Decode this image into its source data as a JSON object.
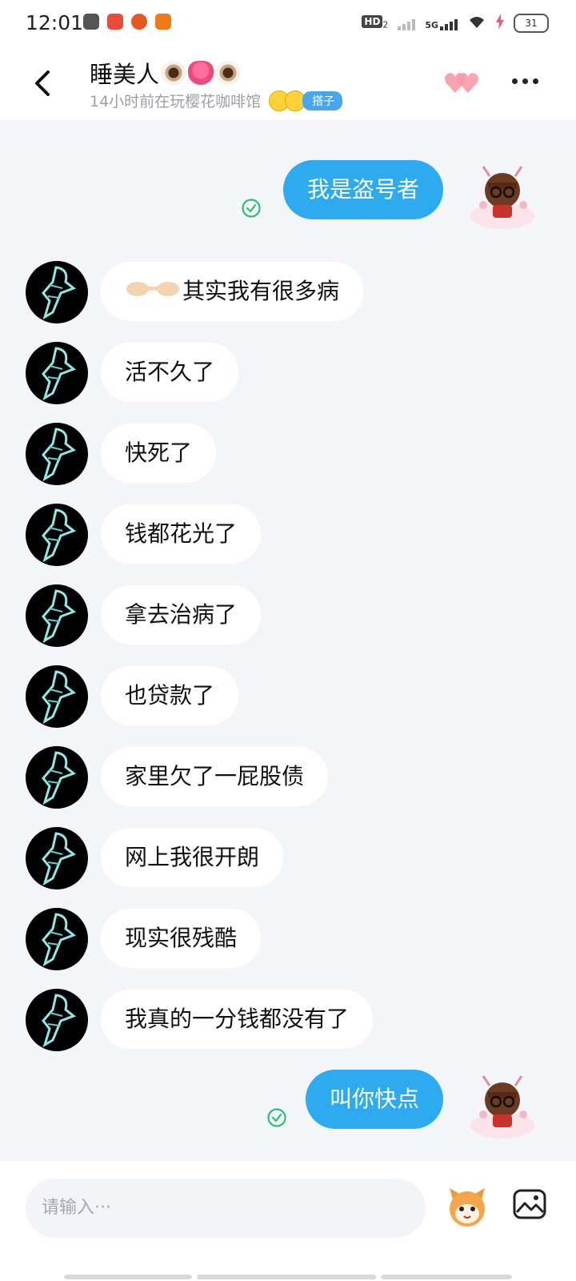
{
  "status_bar": {
    "time": "12:01",
    "network": "5G",
    "hd_label": "HD",
    "hd_sub": "2",
    "battery": "31"
  },
  "header": {
    "contact_name": "睡美人",
    "name_emojis": [
      "eye",
      "tongue",
      "eye"
    ],
    "last_active": "14小时前在玩樱花咖啡馆",
    "partner_tag": "搭子",
    "back_icon": "chevron-left-icon",
    "more_icon": "more-dots-icon",
    "hearts_icon": "double-heart-icon"
  },
  "colors": {
    "sent_bubble": "#2eaaf0",
    "received_bubble": "#ffffff",
    "chat_background": "#f3f5f9",
    "read_check": "#2bbf6e"
  },
  "messages": [
    {
      "side": "sent",
      "text": "我是盗号者",
      "read": true
    },
    {
      "side": "received",
      "emoji": "pointing-hands",
      "text": "其实我有很多病"
    },
    {
      "side": "received",
      "text": "活不久了"
    },
    {
      "side": "received",
      "text": "快死了"
    },
    {
      "side": "received",
      "text": "钱都花光了"
    },
    {
      "side": "received",
      "text": "拿去治病了"
    },
    {
      "side": "received",
      "text": "也贷款了"
    },
    {
      "side": "received",
      "text": "家里欠了一屁股债"
    },
    {
      "side": "received",
      "text": "网上我很开朗"
    },
    {
      "side": "received",
      "text": "现实很残酷"
    },
    {
      "side": "received",
      "text": "我真的一分钱都没有了"
    },
    {
      "side": "sent",
      "text": "叫你快点",
      "read": true
    }
  ],
  "input": {
    "placeholder": "请输入···"
  }
}
